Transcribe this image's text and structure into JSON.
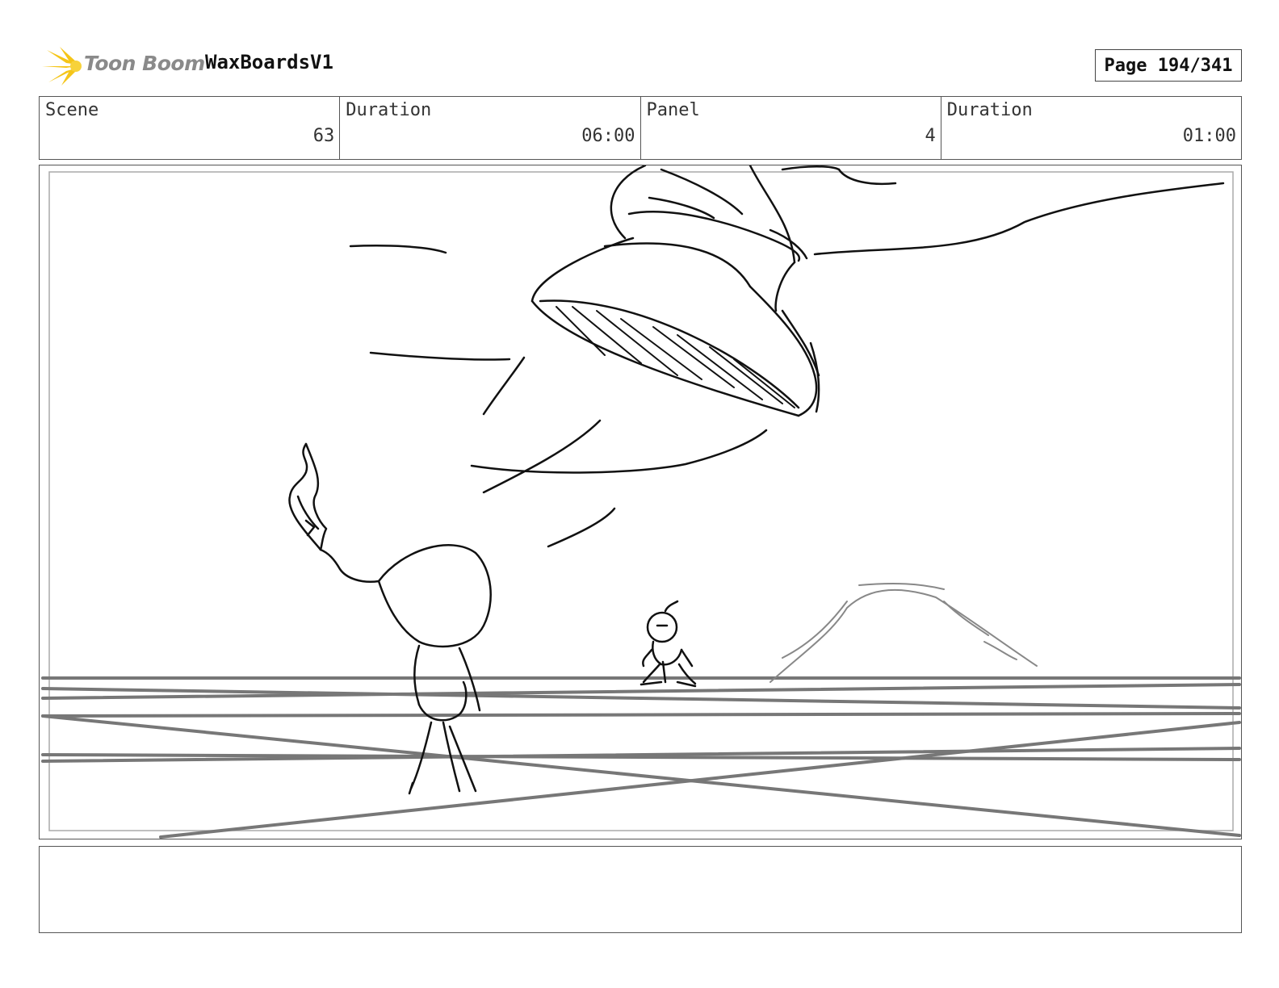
{
  "header": {
    "logo_text": "Toon Boom",
    "project_title": "WaxBoardsV1",
    "page_label": "Page 194/341"
  },
  "info": [
    {
      "label": "Scene",
      "value": "63"
    },
    {
      "label": "Duration",
      "value": "06:00"
    },
    {
      "label": "Panel",
      "value": "4"
    },
    {
      "label": "Duration",
      "value": "01:00"
    }
  ],
  "panel": {
    "sketch": "storyboard-sketch"
  },
  "notes": {
    "text": ""
  },
  "colors": {
    "logo_star": "#f5c518",
    "logo_text": "#8a8a8a",
    "ink": "#111111",
    "guide_lines": "#777777"
  }
}
